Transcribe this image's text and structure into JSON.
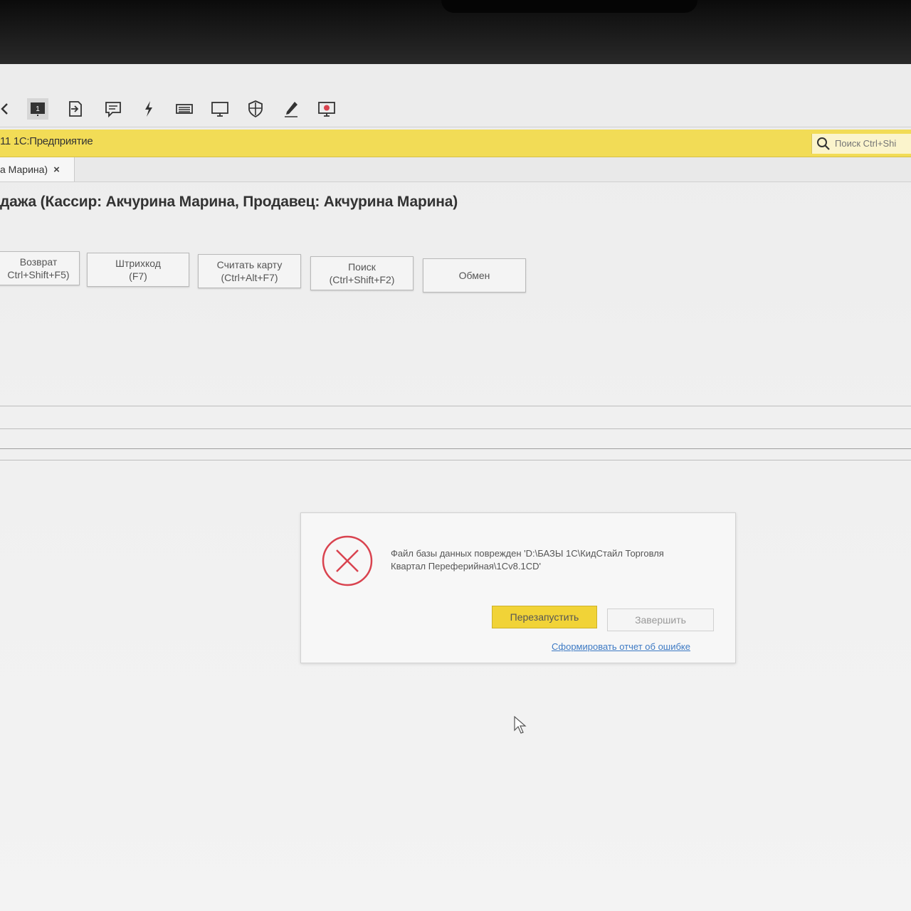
{
  "toolbar": {
    "icons": [
      "arrow-left-icon",
      "window-1-icon",
      "exit-icon",
      "comment-icon",
      "lightning-icon",
      "keyboard-icon",
      "monitor-icon",
      "shield-icon",
      "pen-icon",
      "record-icon"
    ],
    "active_window_number": "1"
  },
  "app": {
    "title": "11 1С:Предприятие",
    "search_placeholder": "Поиск Ctrl+Shi"
  },
  "tab": {
    "label": "а Марина)",
    "close": "×"
  },
  "document": {
    "title": "дажа (Кассир: Акчурина Марина, Продавец: Акчурина Марина)"
  },
  "commands": [
    {
      "line1": "Возврат",
      "line2": "Ctrl+Shift+F5)"
    },
    {
      "line1": "Штрихкод",
      "line2": "(F7)"
    },
    {
      "line1": "Считать карту",
      "line2": "(Ctrl+Alt+F7)"
    },
    {
      "line1": "Поиск",
      "line2": "(Ctrl+Shift+F2)"
    },
    {
      "line1": "Обмен",
      "line2": ""
    }
  ],
  "error_dialog": {
    "message_line1": "Файл базы данных поврежден 'D:\\БАЗЫ 1С\\КидСтайл Торговля",
    "message_line2": "Квартал Переферийная\\1Cv8.1CD'",
    "restart_label": "Перезапустить",
    "finish_label": "Завершить",
    "report_link": "Сформировать отчет об ошибке",
    "accent_color": "#f1d337",
    "error_color": "#d9434f"
  }
}
